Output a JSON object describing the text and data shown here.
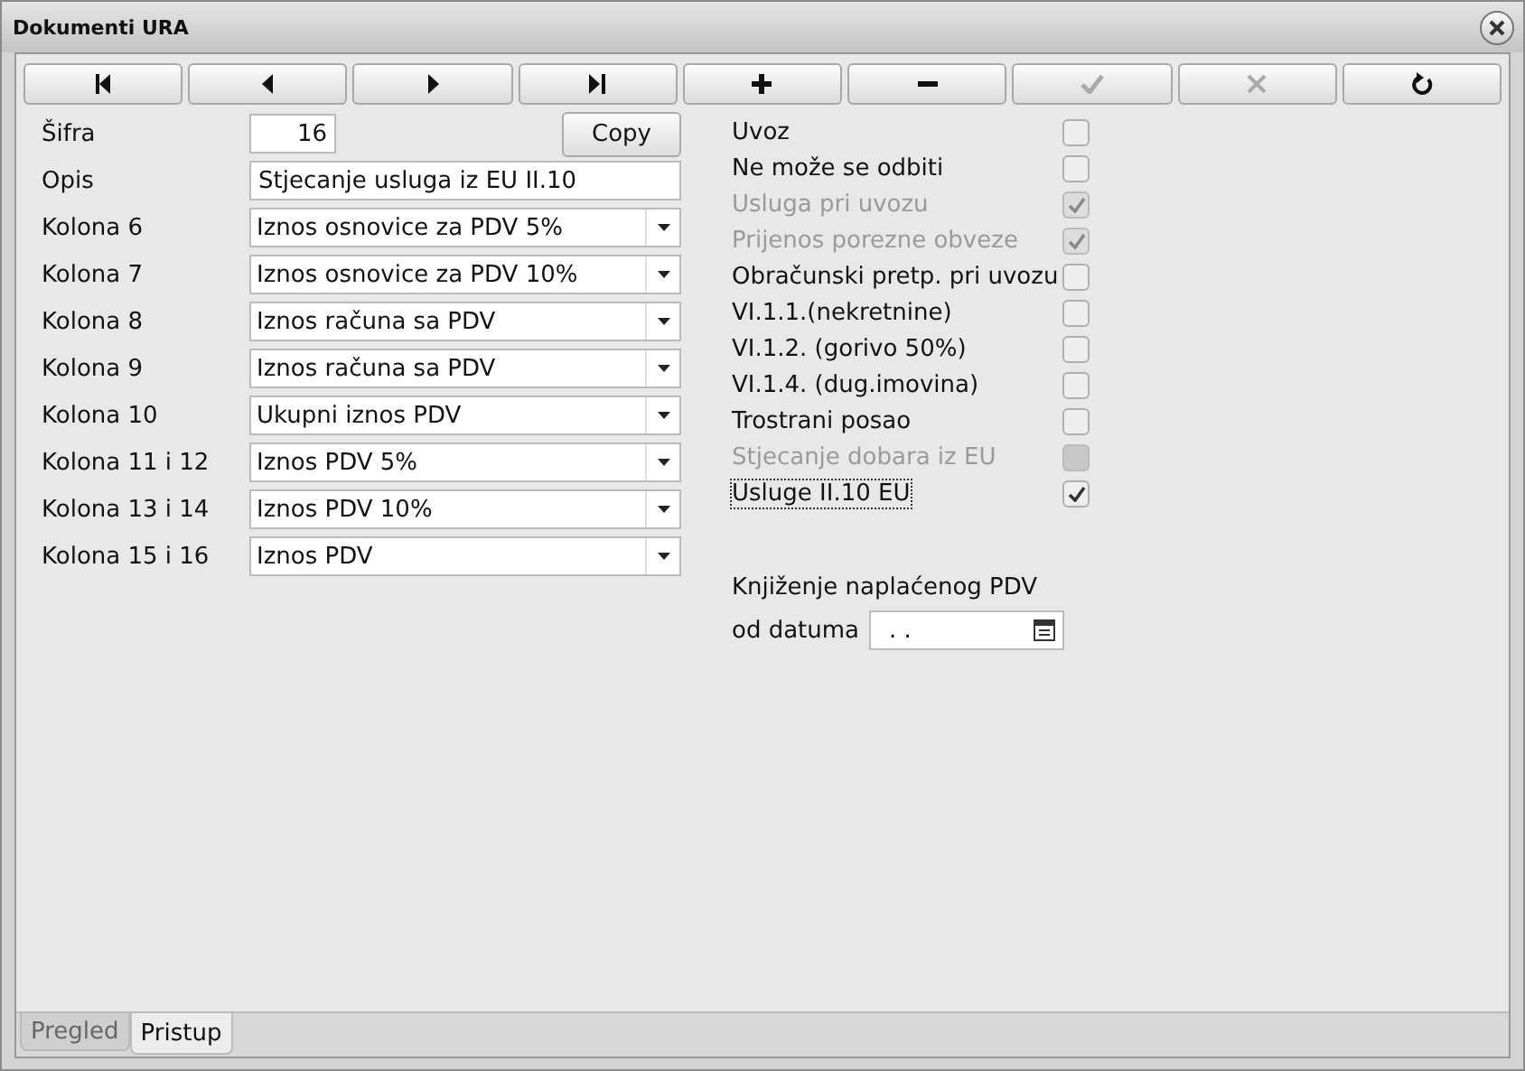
{
  "window": {
    "title": "Dokumenti URA"
  },
  "toolbar": [
    {
      "kind": "first",
      "disabled": false
    },
    {
      "kind": "prev",
      "disabled": false
    },
    {
      "kind": "next",
      "disabled": false
    },
    {
      "kind": "last",
      "disabled": false
    },
    {
      "kind": "add",
      "disabled": false
    },
    {
      "kind": "remove",
      "disabled": false
    },
    {
      "kind": "confirm",
      "disabled": true
    },
    {
      "kind": "cancel",
      "disabled": true
    },
    {
      "kind": "refresh",
      "disabled": false
    }
  ],
  "sifra": {
    "label": "Šifra",
    "value": "16"
  },
  "copy_button": "Copy",
  "opis": {
    "label": "Opis",
    "value": "Stjecanje usluga iz EU II.10"
  },
  "columns": [
    {
      "label": "Kolona 6",
      "value": "Iznos osnovice za PDV 5%"
    },
    {
      "label": "Kolona 7",
      "value": "Iznos osnovice za PDV 10%"
    },
    {
      "label": "Kolona 8",
      "value": "Iznos računa sa PDV"
    },
    {
      "label": "Kolona 9",
      "value": "Iznos računa sa PDV"
    },
    {
      "label": "Kolona 10",
      "value": "Ukupni iznos PDV"
    },
    {
      "label": "Kolona 11 i 12",
      "value": "Iznos PDV 5%"
    },
    {
      "label": "Kolona 13 i 14",
      "value": "Iznos PDV 10%"
    },
    {
      "label": "Kolona 15 i 16",
      "value": "Iznos PDV"
    }
  ],
  "options": [
    {
      "label": "Uvoz",
      "checked": false,
      "disabled": false,
      "focused": false
    },
    {
      "label": "Ne može se odbiti",
      "checked": false,
      "disabled": false,
      "focused": false
    },
    {
      "label": "Usluga pri uvozu",
      "checked": true,
      "disabled": true,
      "focused": false
    },
    {
      "label": "Prijenos porezne obveze",
      "checked": true,
      "disabled": true,
      "focused": false
    },
    {
      "label": "Obračunski pretp. pri uvozu",
      "checked": false,
      "disabled": false,
      "focused": false
    },
    {
      "label": "VI.1.1.(nekretnine)",
      "checked": false,
      "disabled": false,
      "focused": false
    },
    {
      "label": "VI.1.2. (gorivo 50%)",
      "checked": false,
      "disabled": false,
      "focused": false
    },
    {
      "label": "VI.1.4. (dug.imovina)",
      "checked": false,
      "disabled": false,
      "focused": false
    },
    {
      "label": "Trostrani posao",
      "checked": false,
      "disabled": false,
      "focused": false
    },
    {
      "label": "Stjecanje dobara iz EU",
      "checked": false,
      "disabled": true,
      "focused": false
    },
    {
      "label": "Usluge II.10 EU",
      "checked": true,
      "disabled": false,
      "focused": true
    }
  ],
  "booking": {
    "heading": "Knjiženje naplaćenog PDV",
    "date_label": "od datuma",
    "date_value": ". ."
  },
  "tabs": [
    {
      "label": "Pregled",
      "selected": false
    },
    {
      "label": "Pristup",
      "selected": true
    }
  ]
}
